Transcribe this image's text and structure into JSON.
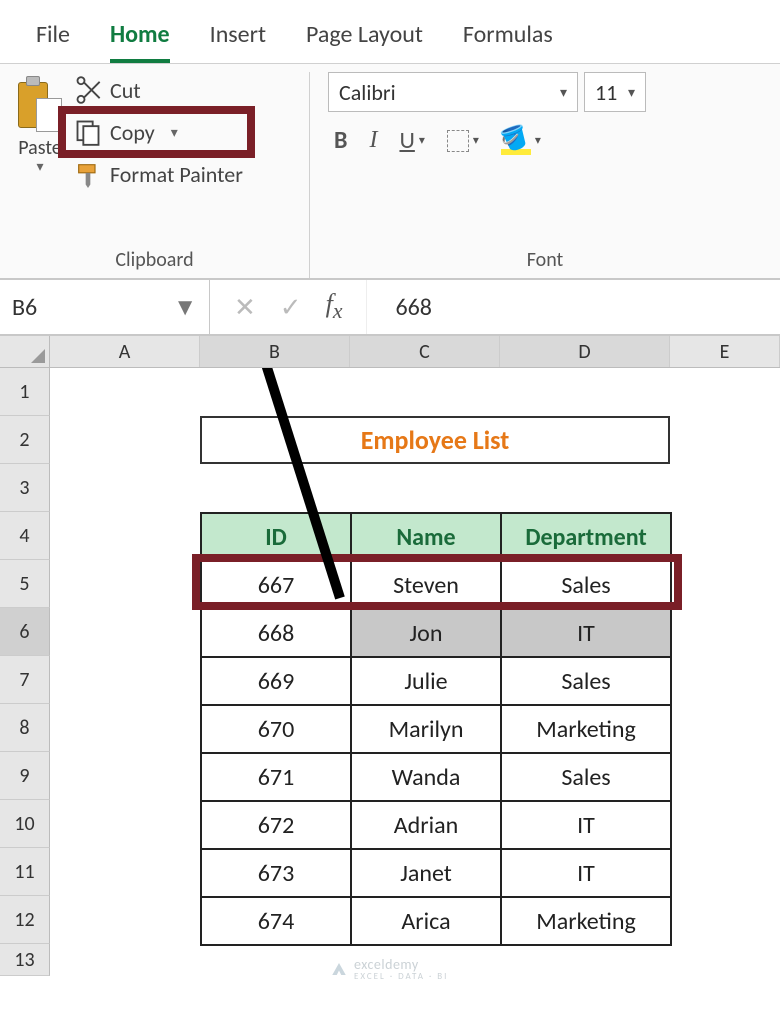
{
  "tabs": {
    "file": "File",
    "home": "Home",
    "insert": "Insert",
    "page_layout": "Page Layout",
    "formulas": "Formulas"
  },
  "clipboard": {
    "paste_label": "Paste",
    "cut_label": "Cut",
    "copy_label": "Copy",
    "format_painter_label": "Format Painter",
    "group_label": "Clipboard"
  },
  "font": {
    "family": "Calibri",
    "size": "11",
    "bold": "B",
    "italic": "I",
    "underline": "U",
    "group_label": "Font"
  },
  "name_box": "B6",
  "formula_value": "668",
  "columns": {
    "A": "A",
    "B": "B",
    "C": "C",
    "D": "D",
    "E": "E"
  },
  "rows": [
    "1",
    "2",
    "3",
    "4",
    "5",
    "6",
    "7",
    "8",
    "9",
    "10",
    "11",
    "12",
    "13"
  ],
  "sheet": {
    "title": "Employee List",
    "headers": {
      "id": "ID",
      "name": "Name",
      "dept": "Department"
    },
    "data": [
      {
        "id": "667",
        "name": "Steven",
        "dept": "Sales"
      },
      {
        "id": "668",
        "name": "Jon",
        "dept": "IT"
      },
      {
        "id": "669",
        "name": "Julie",
        "dept": "Sales"
      },
      {
        "id": "670",
        "name": "Marilyn",
        "dept": "Marketing"
      },
      {
        "id": "671",
        "name": "Wanda",
        "dept": "Sales"
      },
      {
        "id": "672",
        "name": "Adrian",
        "dept": "IT"
      },
      {
        "id": "673",
        "name": "Janet",
        "dept": "IT"
      },
      {
        "id": "674",
        "name": "Arica",
        "dept": "Marketing"
      }
    ],
    "selected_row_index": 1
  },
  "watermark": {
    "brand": "exceldemy",
    "tag": "EXCEL · DATA · BI"
  },
  "chart_data": {
    "type": "table",
    "title": "Employee List",
    "columns": [
      "ID",
      "Name",
      "Department"
    ],
    "rows": [
      [
        667,
        "Steven",
        "Sales"
      ],
      [
        668,
        "Jon",
        "IT"
      ],
      [
        669,
        "Julie",
        "Sales"
      ],
      [
        670,
        "Marilyn",
        "Marketing"
      ],
      [
        671,
        "Wanda",
        "Sales"
      ],
      [
        672,
        "Adrian",
        "IT"
      ],
      [
        673,
        "Janet",
        "IT"
      ],
      [
        674,
        "Arica",
        "Marketing"
      ]
    ]
  }
}
